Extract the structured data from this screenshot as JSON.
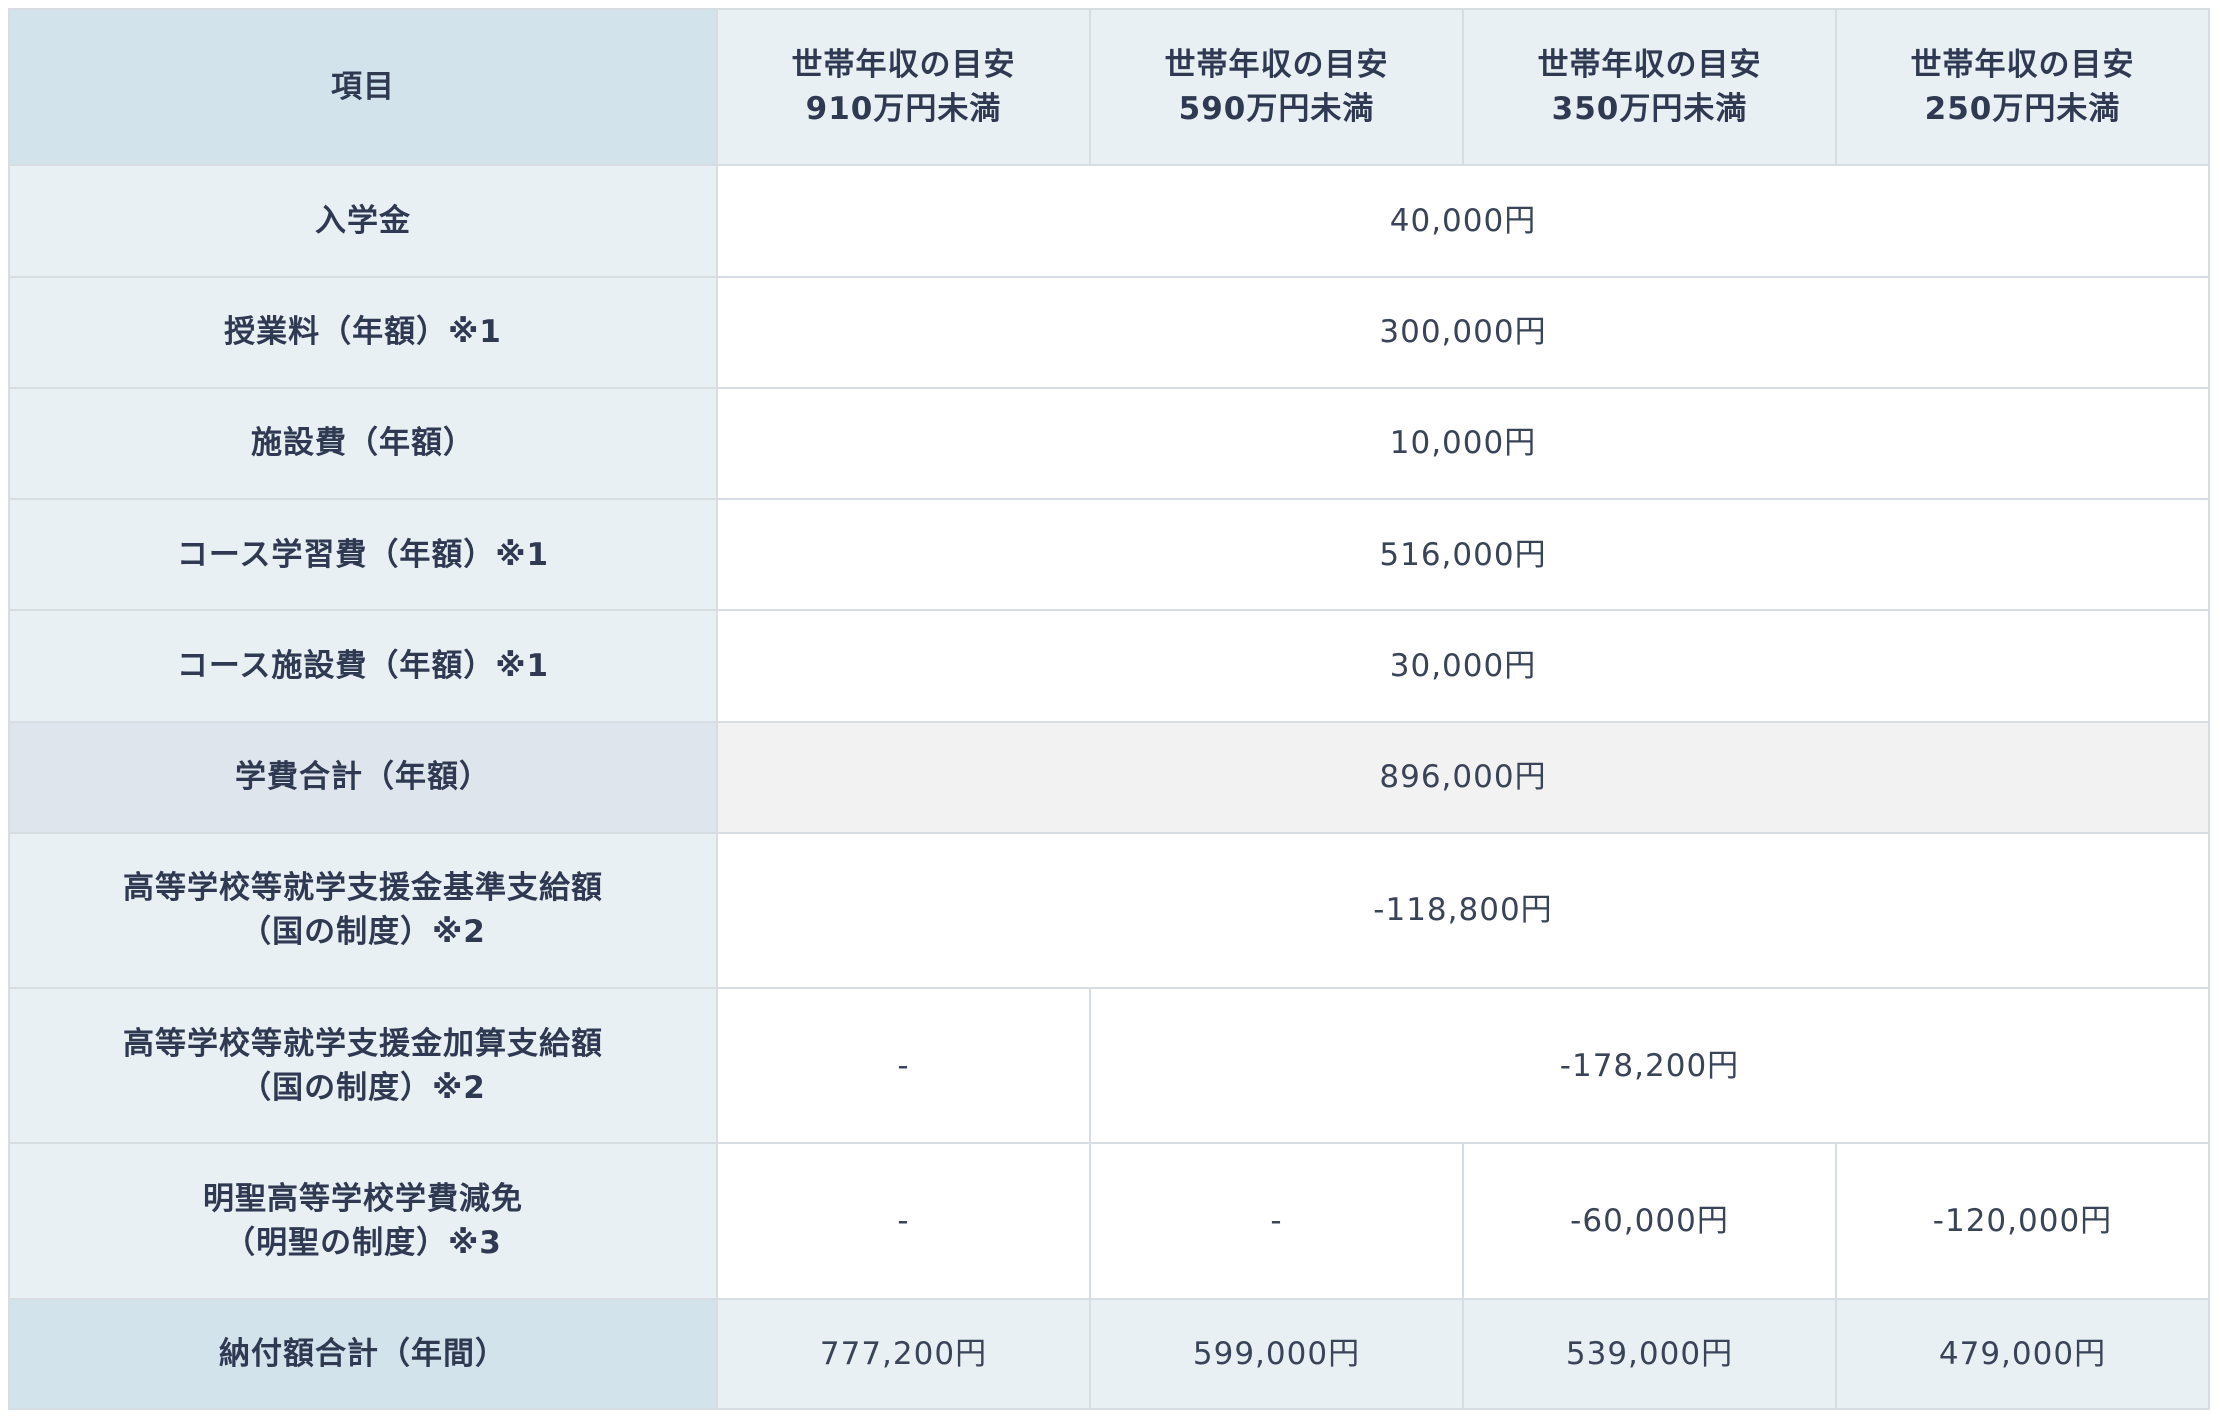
{
  "header": {
    "item_label": "項目",
    "bands": [
      {
        "line1": "世帯年収の目安",
        "line2": "910万円未満"
      },
      {
        "line1": "世帯年収の目安",
        "line2": "590万円未満"
      },
      {
        "line1": "世帯年収の目安",
        "line2": "350万円未満"
      },
      {
        "line1": "世帯年収の目安",
        "line2": "250万円未満"
      }
    ]
  },
  "rows": {
    "admission": {
      "label": "入学金",
      "value": "40,000円"
    },
    "tuition": {
      "label": "授業料（年額）※1",
      "value": "300,000円"
    },
    "facility": {
      "label": "施設費（年額）",
      "value": "10,000円"
    },
    "course_study": {
      "label": "コース学習費（年額）※1",
      "value": "516,000円"
    },
    "course_facility": {
      "label": "コース施設費（年額）※1",
      "value": "30,000円"
    },
    "subtotal": {
      "label": "学費合計（年額）",
      "value": "896,000円"
    },
    "support_base": {
      "label_line1": "高等学校等就学支援金基準支給額",
      "label_line2": "（国の制度）※2",
      "value": "-118,800円"
    },
    "support_add": {
      "label_line1": "高等学校等就学支援金加算支給額",
      "label_line2": "（国の制度）※2",
      "value_band1": "-",
      "value_rest": "-178,200円"
    },
    "meisei_reduction": {
      "label_line1": "明聖高等学校学費減免",
      "label_line2": "（明聖の制度）※3",
      "values": [
        "-",
        "-",
        "-60,000円",
        "-120,000円"
      ]
    },
    "total": {
      "label": "納付額合計（年間）",
      "values": [
        "777,200円",
        "599,000円",
        "539,000円",
        "479,000円"
      ]
    }
  }
}
